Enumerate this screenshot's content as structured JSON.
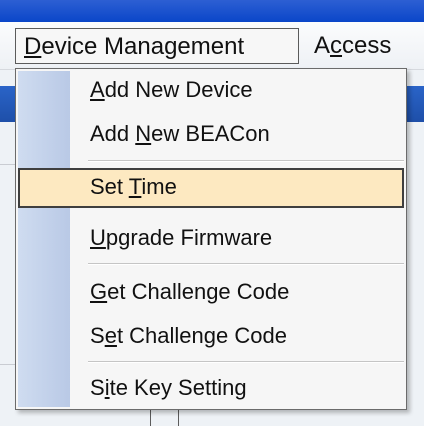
{
  "menubar": {
    "items": [
      {
        "before": "",
        "key": "D",
        "after": "evice Management"
      },
      {
        "before": "A",
        "key": "c",
        "after": "cess"
      }
    ]
  },
  "menu": {
    "items": [
      {
        "before": "",
        "key": "A",
        "after": "dd New Device"
      },
      {
        "before": "Add ",
        "key": "N",
        "after": "ew BEACon"
      },
      {
        "before": "Set ",
        "key": "T",
        "after": "ime"
      },
      {
        "before": "",
        "key": "U",
        "after": "pgrade Firmware"
      },
      {
        "before": "",
        "key": "G",
        "after": "et Challenge Code"
      },
      {
        "before": "S",
        "key": "e",
        "after": "t Challenge Code"
      },
      {
        "before": "S",
        "key": "i",
        "after": "te Key Setting"
      }
    ],
    "highlighted_index": 2
  },
  "colors": {
    "highlight": "#fde9c1",
    "gutter": "#c4d3ec",
    "titlebar": "#0a46c9"
  }
}
